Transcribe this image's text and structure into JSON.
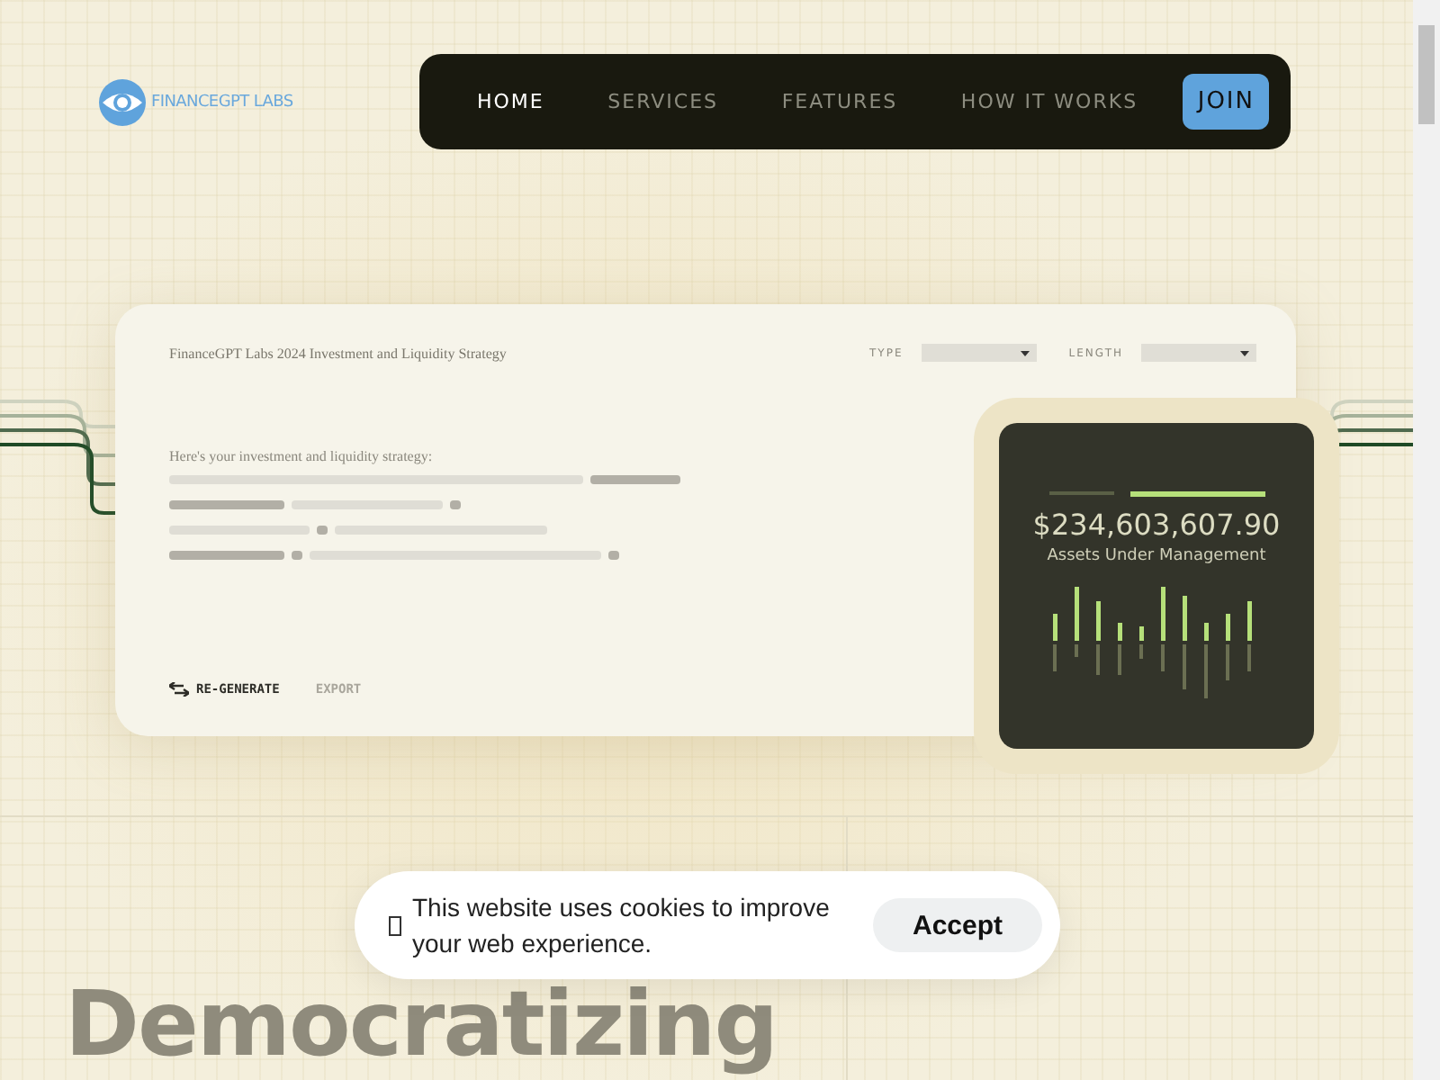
{
  "logo": {
    "text": "FINANCEGPT LABS"
  },
  "nav": {
    "items": [
      {
        "label": "HOME",
        "selected": true
      },
      {
        "label": "SERVICES",
        "selected": false
      },
      {
        "label": "FEATURES",
        "selected": false
      },
      {
        "label": "HOW IT WORKS",
        "selected": false
      }
    ],
    "cta": "JOIN"
  },
  "preview": {
    "title": "FinanceGPT Labs 2024 Investment and Liquidity Strategy",
    "filters": [
      {
        "label": "TYPE"
      },
      {
        "label": "LENGTH"
      }
    ],
    "intro": "Here's your investment and liquidity strategy:",
    "actions": [
      {
        "label": "RE-GENERATE",
        "kind": "primary"
      },
      {
        "label": "EXPORT",
        "kind": "muted"
      }
    ]
  },
  "stats": {
    "amount": "$234,603,607.90",
    "caption": "Assets Under Management"
  },
  "hero": {
    "heading_lines": [
      "Democratizing"
    ]
  },
  "cookie": {
    "text": "This website uses cookies to improve your web experience.",
    "button": "Accept"
  }
}
